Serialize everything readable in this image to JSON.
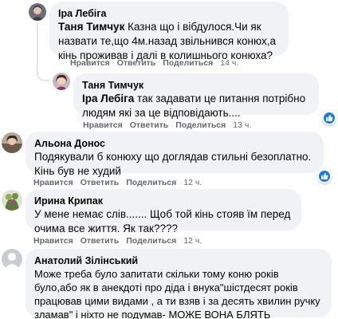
{
  "actions": {
    "like": "Нравится",
    "reply": "Ответить",
    "share": "Поделиться"
  },
  "colors": {
    "bubble": "#f0f2f5",
    "like": "#1877f2",
    "meta": "#65676b"
  },
  "comments": [
    {
      "author": "Іра Лебіга",
      "tag": "Таня Тимчук",
      "text": " Казна що і вібдулося.Чи як назвати те,що 4м.назад звільнився конюх,а кінь проживав і далі в колишнього конюха?",
      "time": "14 ч."
    },
    {
      "author": "Таня Тимчук",
      "tag": "Іра Лебіга",
      "text": " так задавати це питання потрібно людям які за це відповідають....",
      "time": "13 ч.",
      "reaction_icon": "like-icon"
    },
    {
      "author": "Альона Донос",
      "text": "Подякували б конюху що доглядав стильні безоплатно. Кінь був не худий",
      "time": "12 ч.",
      "reaction_icon": "like-icon"
    },
    {
      "author": "Ирина Крипак",
      "text": "У мене немає слів....... Щоб той кінь стояв їм перед очима все життя. Як так????",
      "time": "12 ч."
    },
    {
      "author": "Анатолий Зілінський",
      "text": "Може треба було запитати скільки тому коню років було,або як в анекдоті про діда і внука\"шістдесят років працював цими видами , а ти взяв і за десять хвилин ручку зламав\" і ніхто не подумав- МОЖЕ ВОНА БЛЯТЬ СТРУХЛА!?!?!?"
    }
  ]
}
